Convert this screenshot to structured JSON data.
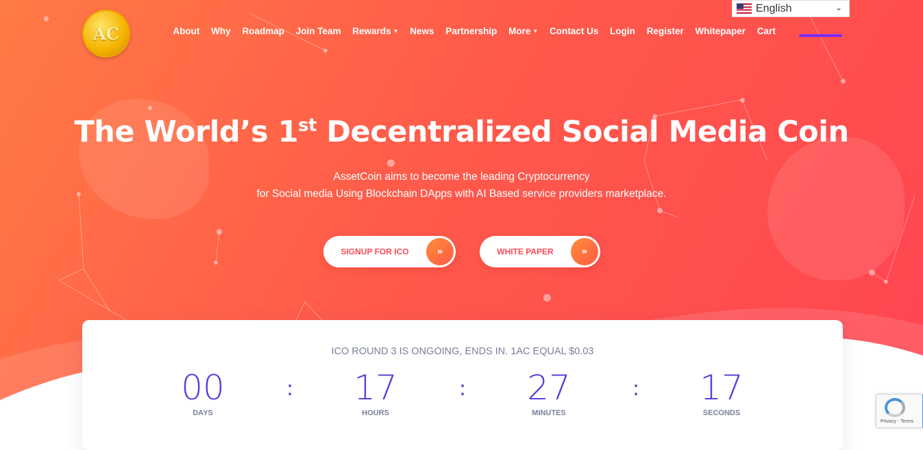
{
  "language": {
    "selected": "English"
  },
  "logo": {
    "text": "AC"
  },
  "nav": {
    "items": [
      {
        "label": "About",
        "has_caret": false
      },
      {
        "label": "Why",
        "has_caret": false
      },
      {
        "label": "Roadmap",
        "has_caret": false
      },
      {
        "label": "Join Team",
        "has_caret": false
      },
      {
        "label": "Rewards",
        "has_caret": true
      },
      {
        "label": "News",
        "has_caret": false
      },
      {
        "label": "Partnership",
        "has_caret": false
      },
      {
        "label": "More",
        "has_caret": true
      },
      {
        "label": "Contact Us",
        "has_caret": false
      },
      {
        "label": "Login",
        "has_caret": false
      },
      {
        "label": "Register",
        "has_caret": false
      },
      {
        "label": "Whitepaper",
        "has_caret": false
      },
      {
        "label": "Cart",
        "has_caret": false
      }
    ],
    "active_underline_color": "#7b2cff"
  },
  "hero": {
    "headline_before": "The World’s 1",
    "headline_sup": "st",
    "headline_after": " Decentralized Social Media Coin",
    "subtitle_line1": "AssetCoin aims to become the leading Cryptocurrency",
    "subtitle_line2": "for Social media Using Blockchain DApps with AI Based service providers marketplace.",
    "buttons": {
      "signup": "SIGNUP FOR ICO",
      "whitepaper": "WHITE PAPER"
    },
    "button_icon": "double-chevron-right-icon"
  },
  "countdown": {
    "title": "ICO ROUND 3 IS ONGOING, ENDS IN. 1AC EQUAL $0.03",
    "units": [
      {
        "value": "00",
        "label": "DAYS"
      },
      {
        "value": "17",
        "label": "HOURS"
      },
      {
        "value": "27",
        "label": "MINUTES"
      },
      {
        "value": "17",
        "label": "SECONDS"
      }
    ],
    "separator": ":"
  },
  "recaptcha": {
    "terms": "Privacy - Terms"
  },
  "colors": {
    "gradient_start": "#ff7a45",
    "gradient_end": "#ff4452",
    "accent_purple": "#5b3fd6",
    "button_text": "#ff4a55"
  }
}
